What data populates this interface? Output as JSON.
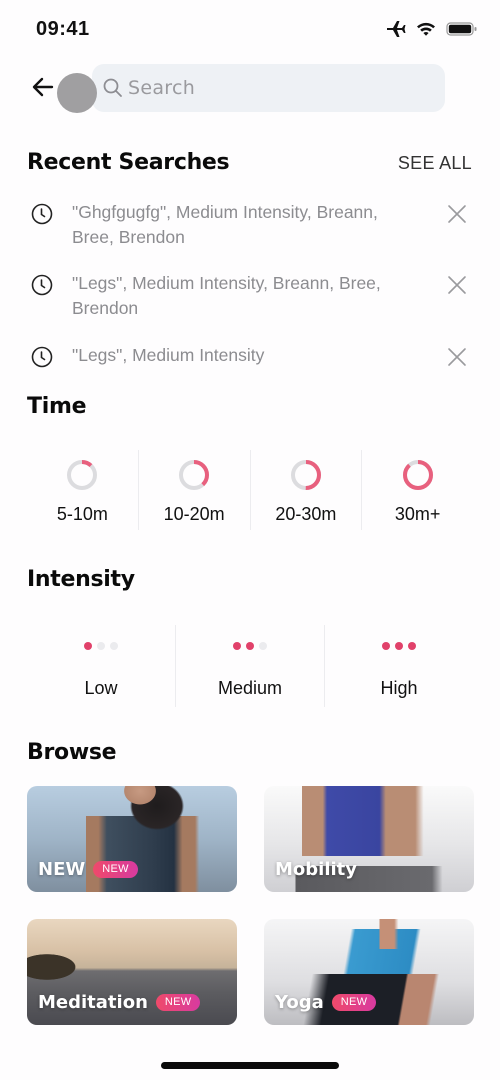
{
  "status_bar": {
    "time": "09:41",
    "icons": [
      "airplane-icon",
      "wifi-icon",
      "battery-icon"
    ]
  },
  "search": {
    "placeholder": "Search",
    "value": "",
    "back_icon": "arrow-left-icon",
    "search_icon": "magnifier-icon"
  },
  "recent_searches": {
    "title": "Recent Searches",
    "see_all_label": "SEE ALL",
    "items": [
      {
        "text": "\"Ghgfgugfg\", Medium Intensity, Breann, Bree, Brendon"
      },
      {
        "text": "\"Legs\", Medium Intensity, Breann, Bree, Brendon"
      },
      {
        "text": "\"Legs\", Medium Intensity"
      }
    ]
  },
  "time": {
    "title": "Time",
    "options": [
      {
        "label": "5-10m",
        "fill": 0.12
      },
      {
        "label": "10-20m",
        "fill": 0.38
      },
      {
        "label": "20-30m",
        "fill": 0.5
      },
      {
        "label": "30m+",
        "fill": 0.88
      }
    ]
  },
  "intensity": {
    "title": "Intensity",
    "options": [
      {
        "label": "Low",
        "level": 1,
        "max": 3
      },
      {
        "label": "Medium",
        "level": 2,
        "max": 3
      },
      {
        "label": "High",
        "level": 3,
        "max": 3
      }
    ]
  },
  "browse": {
    "title": "Browse",
    "cards": [
      {
        "title": "NEW",
        "badge": "NEW"
      },
      {
        "title": "Mobility",
        "badge": ""
      },
      {
        "title": "Meditation",
        "badge": "NEW"
      },
      {
        "title": "Yoga",
        "badge": "NEW"
      }
    ]
  },
  "colors": {
    "accent": "#e1416a",
    "ring_track": "#dcdcdf",
    "badge_gradient": [
      "#ef4a6a",
      "#d83aa0"
    ]
  }
}
